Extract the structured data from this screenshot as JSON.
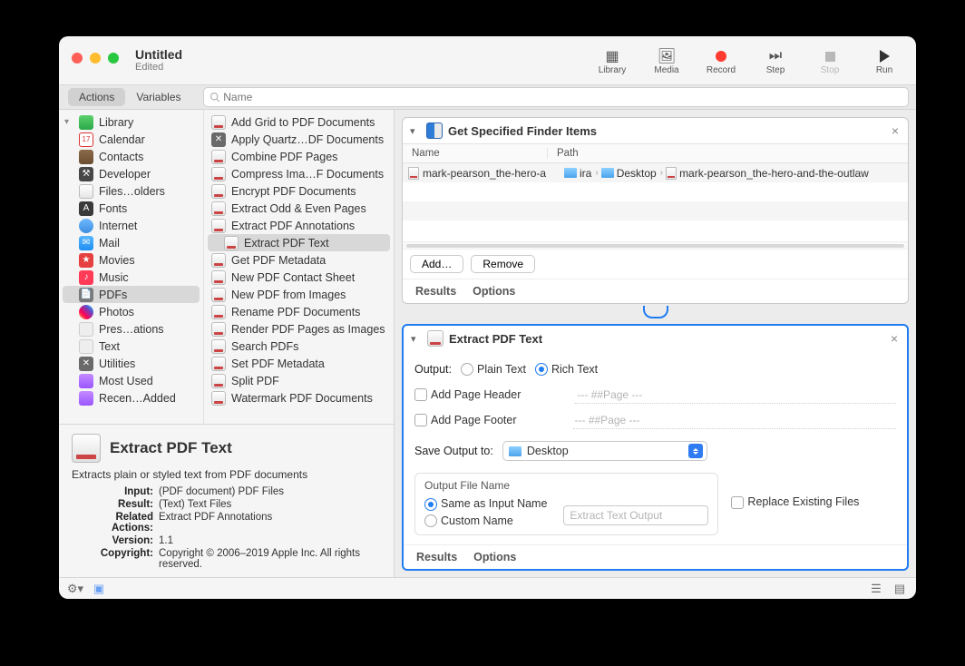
{
  "window": {
    "title": "Untitled",
    "subtitle": "Edited"
  },
  "toolbar": {
    "library": "Library",
    "media": "Media",
    "record": "Record",
    "step": "Step",
    "stop": "Stop",
    "run": "Run"
  },
  "tabs": {
    "actions": "Actions",
    "variables": "Variables",
    "search_placeholder": "Name"
  },
  "library": {
    "root": "Library",
    "items": [
      "Calendar",
      "Contacts",
      "Developer",
      "Files…olders",
      "Fonts",
      "Internet",
      "Mail",
      "Movies",
      "Music",
      "PDFs",
      "Photos",
      "Pres…ations",
      "Text",
      "Utilities"
    ],
    "selected_index": 9,
    "smart": [
      "Most Used",
      "Recen…Added"
    ]
  },
  "actions": {
    "items": [
      "Add Grid to PDF Documents",
      "Apply Quartz…DF Documents",
      "Combine PDF Pages",
      "Compress Ima…F Documents",
      "Encrypt PDF Documents",
      "Extract Odd & Even Pages",
      "Extract PDF Annotations",
      "Extract PDF Text",
      "Get PDF Metadata",
      "New PDF Contact Sheet",
      "New PDF from Images",
      "Rename PDF Documents",
      "Render PDF Pages as Images",
      "Search PDFs",
      "Set PDF Metadata",
      "Split PDF",
      "Watermark PDF Documents"
    ],
    "selected_index": 7
  },
  "detail": {
    "title": "Extract PDF Text",
    "desc": "Extracts plain or styled text from PDF documents",
    "rows": {
      "Input": "(PDF document) PDF Files",
      "Result": "(Text) Text Files",
      "Related Actions": "Extract PDF Annotations",
      "Version": "1.1",
      "Copyright": "Copyright © 2006–2019 Apple Inc. All rights reserved."
    },
    "labels": {
      "input": "Input:",
      "result": "Result:",
      "related": "Related Actions:",
      "version": "Version:",
      "copyright": "Copyright:"
    }
  },
  "workflow": {
    "card1": {
      "title": "Get Specified Finder Items",
      "columns": {
        "name": "Name",
        "path": "Path"
      },
      "row": {
        "filename": "mark-pearson_the-hero-a",
        "crumbs": [
          "ira",
          "Desktop",
          "mark-pearson_the-hero-and-the-outlaw"
        ]
      },
      "add": "Add…",
      "remove": "Remove",
      "results": "Results",
      "options": "Options"
    },
    "card2": {
      "title": "Extract PDF Text",
      "output_label": "Output:",
      "plain": "Plain Text",
      "rich": "Rich Text",
      "add_header": "Add Page Header",
      "header_ph": "--- ##Page ---",
      "add_footer": "Add Page Footer",
      "footer_ph": "--- ##Page ---",
      "save_label": "Save Output to:",
      "save_value": "Desktop",
      "group_title": "Output File Name",
      "same_name": "Same as Input Name",
      "custom_name": "Custom Name",
      "custom_ph": "Extract Text Output",
      "replace": "Replace Existing Files",
      "results": "Results",
      "options": "Options"
    }
  }
}
